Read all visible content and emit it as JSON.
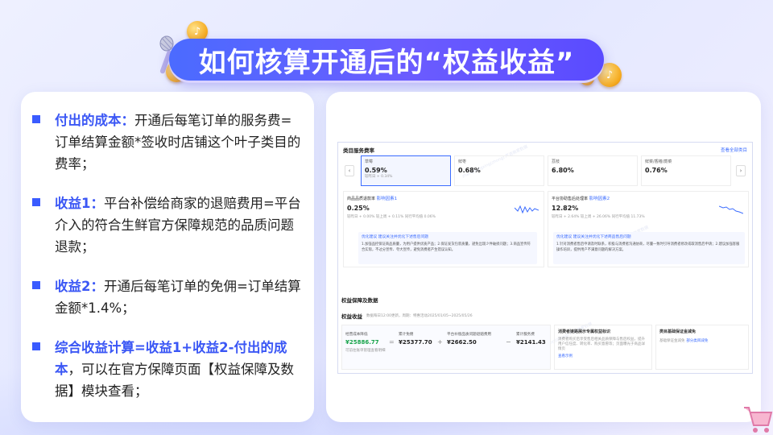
{
  "title": "如何核算开通后的“权益收益”",
  "colors": {
    "accent": "#3b57f5",
    "banner": "#5a5cff",
    "positive": "#17a34a"
  },
  "left": {
    "items": [
      {
        "label": "付出的成本：",
        "text": "开通后每笔订单的服务费=订单结算金额*签收时店铺这个叶子类目的费率；"
      },
      {
        "label": "收益1：",
        "text": "平台补偿给商家的退赔费用=平台介入的符合生鲜官方保障规范的品质问题退款；"
      },
      {
        "label": "收益2：",
        "text": "开通后每笔订单的免佣=订单结算金额*1.4%；"
      },
      {
        "label": "综合收益计算=收益1+收益2-付出的成本",
        "text": "，可以在官方保障页面【权益保障及数据】模块查看；"
      }
    ]
  },
  "shot": {
    "rate_section_title": "类目服务费率",
    "view_all": "查看全部类目",
    "tabs": [
      {
        "name": "草莓",
        "value": "0.59%",
        "sub": "较昨日 + 0.34%"
      },
      {
        "name": "鲜枣",
        "value": "0.68%",
        "sub": ""
      },
      {
        "name": "荔枝",
        "value": "6.80%",
        "sub": ""
      },
      {
        "name": "鲜菜/香椿/蕨菜",
        "value": "0.76%",
        "sub": ""
      }
    ],
    "panels": [
      {
        "name": "商品品质退款率",
        "badge": "影响因素1",
        "value": "0.25%",
        "detail": "较昨日 + 0.00%  较上周 + 0.11%  同行平均值 0.06%",
        "tip_title": "优化建议 建议关注并优化下述售后问题",
        "tip": "1.加强品控保证商品质量，为用户提供优质产品；2.保证发货包装质量，避免出现少件破损问题；3.商品宣传符合实际，不过分宣传、夸大宣传，避免消费者产生错误认知。"
      },
      {
        "name": "平台协助售后处理率",
        "badge": "影响因素2",
        "value": "12.82%",
        "detail": "较昨日 + 2.64%  较上周 + 26.06%  同行平均值 11.73%",
        "tip_title": "优化建议 建议关注并优化下述商品售后问题",
        "tip": "1.针对消费者售后申请及时联系，积极与消费者沟通协商，尽量一致时引导消费者修改或取消售后申请；2.建议加强客服操作培训，提供用户不满意问题的解决方案。"
      }
    ],
    "benefit_title": "权益保障及数据",
    "benefit_sub_title": "权益收益",
    "benefit_note": "数据每日12:00更新，周期：特惠活动2025/01/05~2025/05/26",
    "metrics": [
      {
        "label": "经营成本降低",
        "value": "¥25886.77",
        "note": "可前往账单管理查看明细"
      },
      {
        "label": "累计免佣",
        "value": "¥25377.70"
      },
      {
        "label": "平台补偿品质问题退赔费用",
        "value": "¥2662.50"
      },
      {
        "label": "累计服务费",
        "value": "¥2141.43"
      }
    ],
    "service_title": "消费者链路展示专属权益标识",
    "service_text": "消费者购买后享受售后相关品质保障与售后权益，提升用户信任度、转化率、购买意愿等；页面曝光于商品详情页",
    "service_link": "查看示例",
    "reduce_title": "类目基础保证金减免",
    "reduce_text": "基础保证金减免",
    "reduce_link": "部分类目减免"
  }
}
